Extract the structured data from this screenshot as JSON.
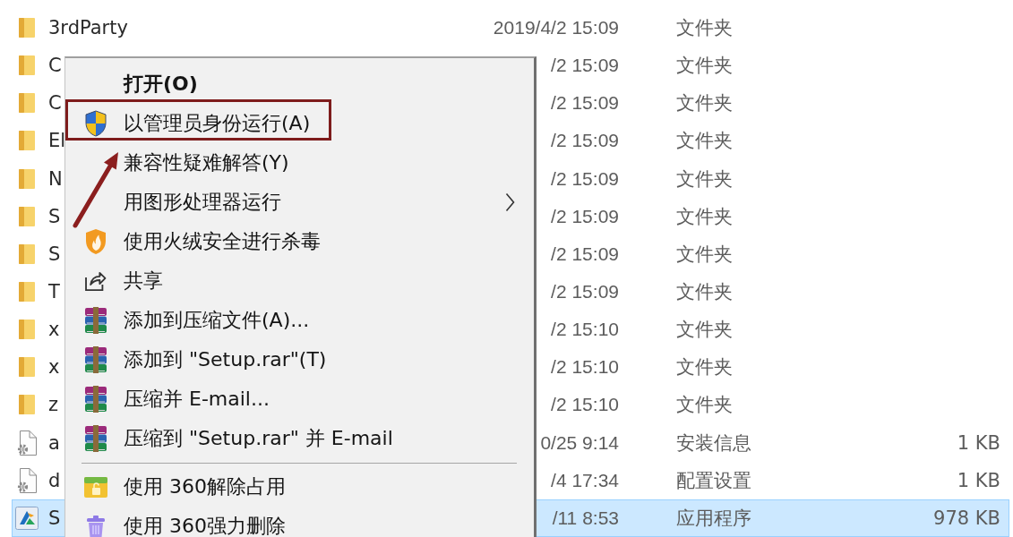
{
  "files": [
    {
      "kind": "folder",
      "name": "3rdParty",
      "date": "2019/4/2 15:09",
      "type": "文件夹",
      "selected": false
    },
    {
      "kind": "folder",
      "name": "C",
      "date": "/2 15:09",
      "type": "文件夹",
      "selected": false
    },
    {
      "kind": "folder",
      "name": "C",
      "date": "/2 15:09",
      "type": "文件夹",
      "selected": false
    },
    {
      "kind": "folder",
      "name": "El",
      "date": "/2 15:09",
      "type": "文件夹",
      "selected": false
    },
    {
      "kind": "folder",
      "name": "N",
      "date": "/2 15:09",
      "type": "文件夹",
      "selected": false
    },
    {
      "kind": "folder",
      "name": "S",
      "date": "/2 15:09",
      "type": "文件夹",
      "selected": false
    },
    {
      "kind": "folder",
      "name": "S",
      "date": "/2 15:09",
      "type": "文件夹",
      "selected": false
    },
    {
      "kind": "folder",
      "name": "T",
      "date": "/2 15:09",
      "type": "文件夹",
      "selected": false
    },
    {
      "kind": "folder",
      "name": "x",
      "date": "/2 15:10",
      "type": "文件夹",
      "selected": false
    },
    {
      "kind": "folder",
      "name": "x",
      "date": "/2 15:10",
      "type": "文件夹",
      "selected": false
    },
    {
      "kind": "folder",
      "name": "z",
      "date": "/2 15:10",
      "type": "文件夹",
      "selected": false
    },
    {
      "kind": "settings",
      "name": "a",
      "date": "0/25 9:14",
      "type": "安装信息",
      "size": "1 KB",
      "selected": false
    },
    {
      "kind": "settings",
      "name": "d",
      "date": "/4 17:34",
      "type": "配置设置",
      "size": "1 KB",
      "selected": false
    },
    {
      "kind": "app",
      "name": "S",
      "date": "/11 8:53",
      "type": "应用程序",
      "size": "978 KB",
      "selected": true
    }
  ],
  "context_menu": {
    "sections": [
      {
        "items": [
          {
            "kind": "plain",
            "label": "打开(O)",
            "default": true,
            "submenu": false,
            "annotated": false
          },
          {
            "kind": "admin",
            "label": "以管理员身份运行(A)",
            "default": false,
            "submenu": false,
            "annotated": true
          },
          {
            "kind": "plain",
            "label": "兼容性疑难解答(Y)",
            "default": false,
            "submenu": false,
            "annotated": false
          },
          {
            "kind": "plain",
            "label": "用图形处理器运行",
            "default": false,
            "submenu": true,
            "annotated": false
          },
          {
            "kind": "antivirus",
            "label": "使用火绒安全进行杀毒",
            "default": false,
            "submenu": false,
            "annotated": false
          },
          {
            "kind": "share",
            "label": "共享",
            "default": false,
            "submenu": false,
            "annotated": false
          },
          {
            "kind": "archive",
            "label": "添加到压缩文件(A)...",
            "default": false,
            "submenu": false,
            "annotated": false
          },
          {
            "kind": "archive",
            "label": "添加到 \"Setup.rar\"(T)",
            "default": false,
            "submenu": false,
            "annotated": false
          },
          {
            "kind": "archive",
            "label": "压缩并 E-mail...",
            "default": false,
            "submenu": false,
            "annotated": false
          },
          {
            "kind": "archive",
            "label": "压缩到 \"Setup.rar\" 并 E-mail",
            "default": false,
            "submenu": false,
            "annotated": false
          }
        ]
      },
      {
        "items": [
          {
            "kind": "unlock",
            "label": "使用 360解除占用",
            "default": false,
            "submenu": false,
            "annotated": false
          },
          {
            "kind": "delete",
            "label": "使用 360强力删除",
            "default": false,
            "submenu": false,
            "annotated": false
          }
        ]
      }
    ]
  }
}
